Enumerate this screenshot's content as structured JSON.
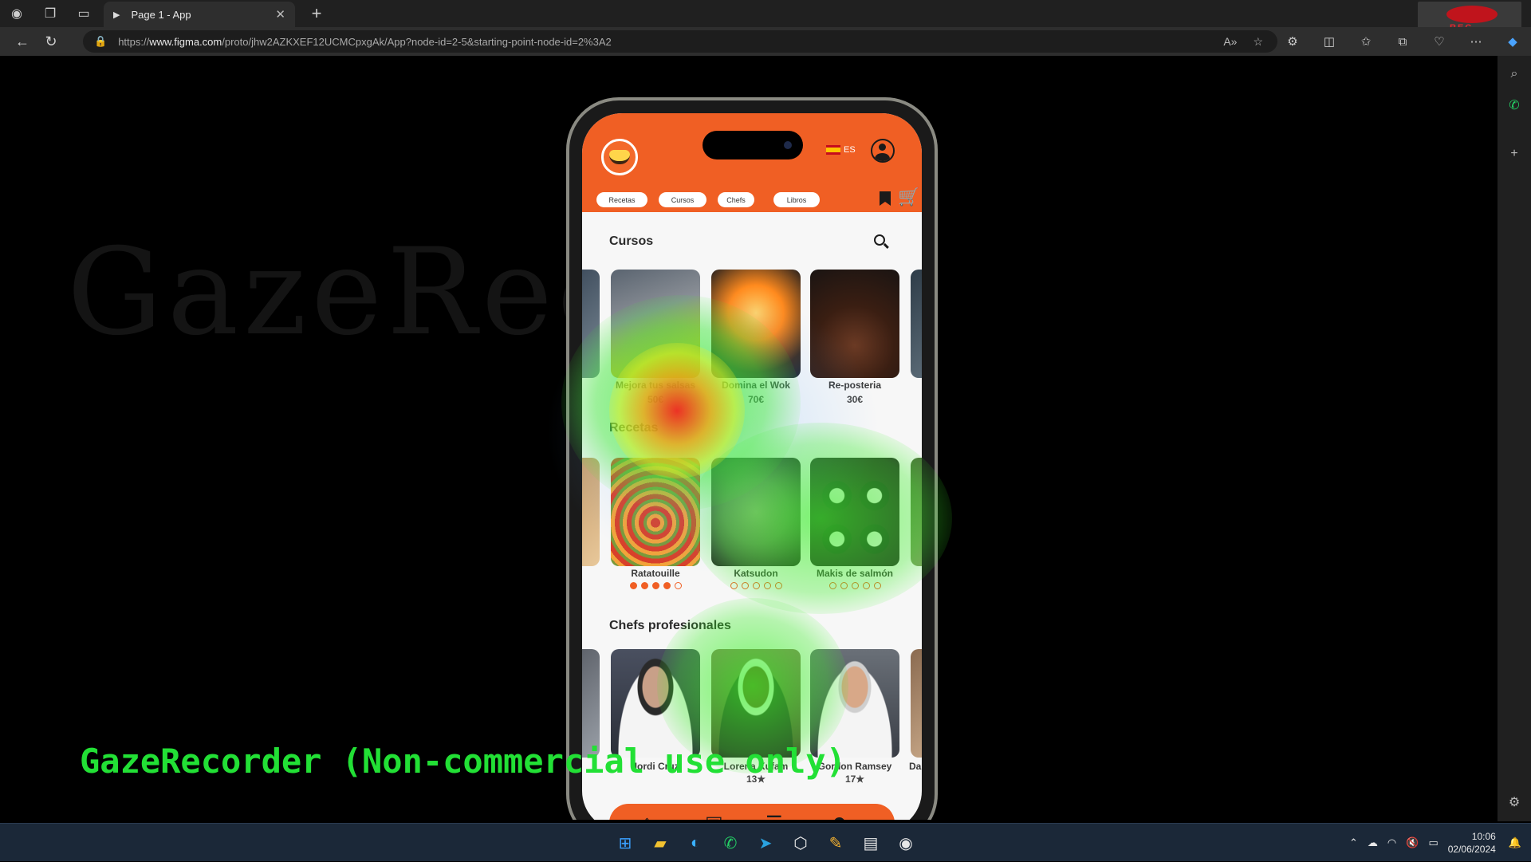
{
  "browser": {
    "tab_title": "Page 1 - App",
    "url_prefix": "https://",
    "url_host": "www.figma.com",
    "url_path": "/proto/jhw2AZKXEF12UCMCpxgAk/App?node-id=2-5&starting-point-node-id=2%3A2",
    "rec_label": "REC"
  },
  "watermark": {
    "ghost_text": "GazeRec",
    "label": "GazeRecorder (Non-commercial use only)"
  },
  "app": {
    "lang": "ES",
    "nav_pills": [
      "Recetas",
      "Cursos",
      "Chefs",
      "Libros"
    ],
    "sections": {
      "cursos": {
        "title": "Cursos",
        "items": [
          {
            "name": "Mejora tus salsas",
            "price": "50€"
          },
          {
            "name": "Domina el Wok",
            "price": "70€"
          },
          {
            "name": "Re-posteria",
            "price": "30€"
          }
        ]
      },
      "recetas": {
        "title": "Recetas",
        "items": [
          {
            "name": "Ratatouille",
            "rating": 4
          },
          {
            "name": "Katsudon",
            "rating": 0
          },
          {
            "name": "Makis de salmón",
            "rating": 0
          }
        ]
      },
      "chefs": {
        "title": "Chefs profesionales",
        "items": [
          {
            "name": "Jordi Cruz",
            "stars": ""
          },
          {
            "name": "Lorena Kufam",
            "stars": "13★"
          },
          {
            "name": "Gordon Ramsey",
            "stars": "17★"
          },
          {
            "name": "Da",
            "stars": ""
          }
        ]
      }
    },
    "icons": [
      "home-icon",
      "image-icon",
      "list-icon",
      "chef-icon"
    ]
  },
  "taskbar": {
    "time": "10:06",
    "date": "02/06/2024"
  },
  "colors": {
    "brand_orange": "#f05f24",
    "heat_green": "#22e035"
  }
}
